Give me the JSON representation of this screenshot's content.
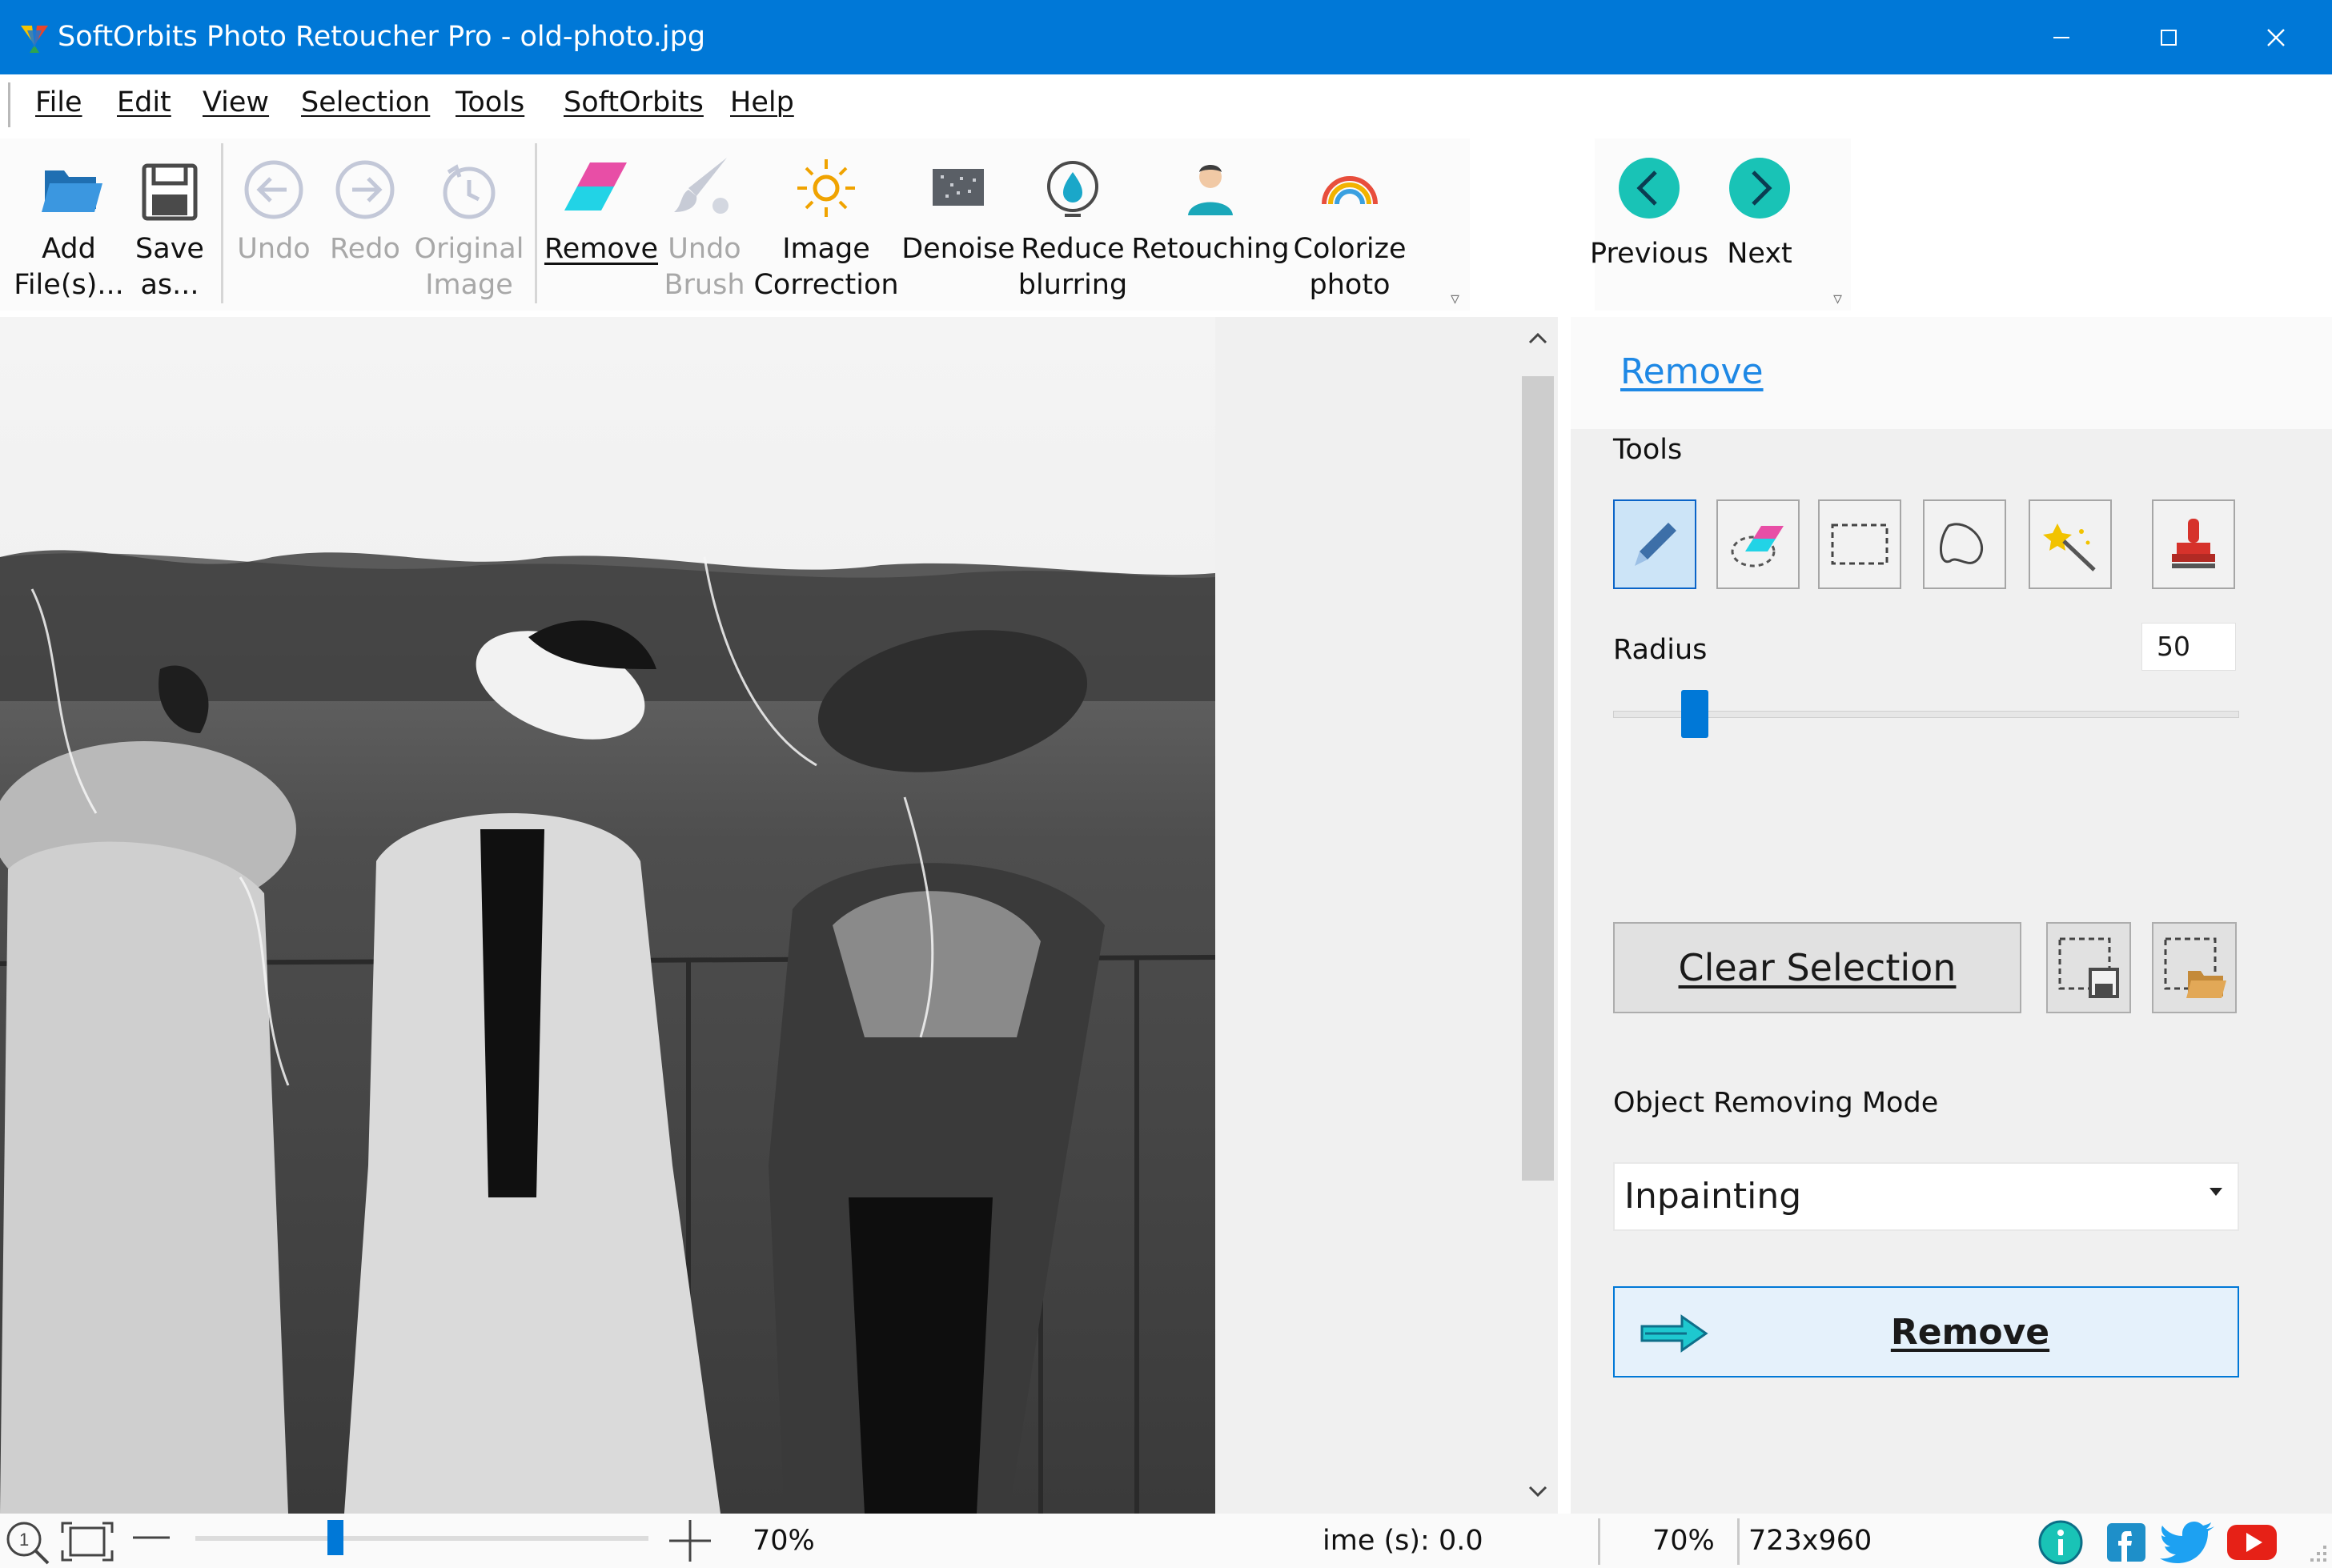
{
  "window": {
    "title": "SoftOrbits Photo Retoucher Pro - old-photo.jpg",
    "accent_color": "#0078d7"
  },
  "menu": {
    "items": [
      "File",
      "Edit",
      "View",
      "Selection",
      "Tools",
      "SoftOrbits",
      "Help"
    ]
  },
  "toolbar": {
    "buttons": [
      {
        "label": "Add\nFile(s)...",
        "icon": "open-folder-icon",
        "enabled": true
      },
      {
        "label": "Save\nas...",
        "icon": "floppy-disk-icon",
        "enabled": true
      },
      {
        "label": "Undo",
        "icon": "undo-arrow-icon",
        "enabled": false
      },
      {
        "label": "Redo",
        "icon": "redo-arrow-icon",
        "enabled": false
      },
      {
        "label": "Original\nImage",
        "icon": "original-image-icon",
        "enabled": false
      },
      {
        "label": "Remove",
        "icon": "eraser-icon",
        "enabled": true
      },
      {
        "label": "Undo\nBrush",
        "icon": "brush-icon",
        "enabled": false
      },
      {
        "label": "Image\nCorrection",
        "icon": "sun-icon",
        "enabled": true
      },
      {
        "label": "Denoise",
        "icon": "denoise-icon",
        "enabled": true
      },
      {
        "label": "Reduce\nblurring",
        "icon": "water-drop-icon",
        "enabled": true
      },
      {
        "label": "Retouching",
        "icon": "person-icon",
        "enabled": true
      },
      {
        "label": "Colorize\nphoto",
        "icon": "rainbow-icon",
        "enabled": true
      }
    ],
    "nav": {
      "previous": "Previous",
      "next": "Next"
    }
  },
  "panel": {
    "title": "Remove",
    "tools_label": "Tools",
    "tools": [
      "marker-icon",
      "eraser-selection-icon",
      "rectangle-select-icon",
      "lasso-icon",
      "magic-wand-icon",
      "stamp-icon"
    ],
    "active_tool": "marker-icon",
    "radius_label": "Radius",
    "radius_value": "50",
    "radius_fraction": 0.13,
    "clear_selection_label": "Clear Selection",
    "mode_label": "Object Removing Mode",
    "mode_value": "Inpainting",
    "remove_label": "Remove"
  },
  "status": {
    "zoom_percent": "70%",
    "time_text": "ime (s): 0.0",
    "zoom_right": "70%",
    "dimensions": "723x960",
    "zoom_slider_fraction": 0.31
  }
}
